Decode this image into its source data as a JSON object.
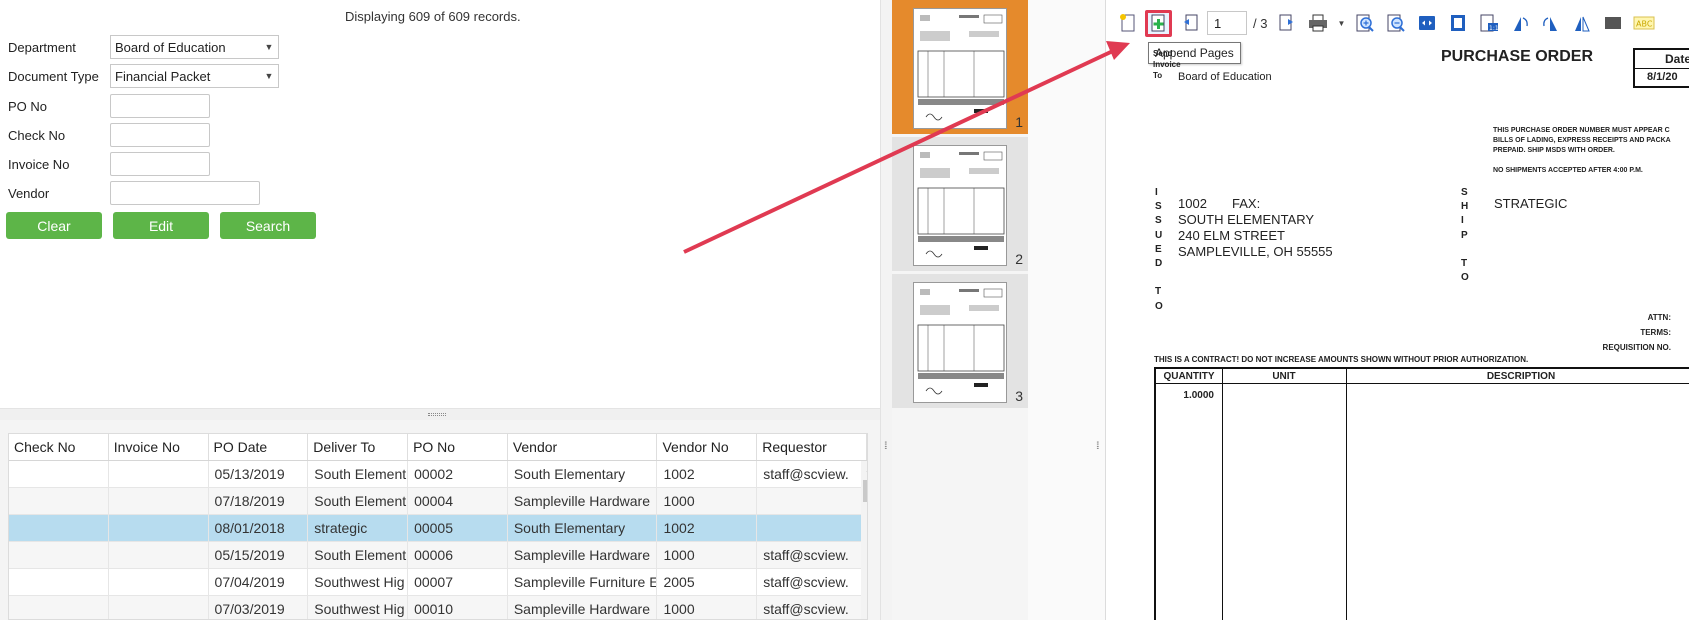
{
  "search": {
    "records_text": "Displaying 609 of 609 records.",
    "fields": [
      {
        "label": "Department",
        "value": "Board of Education",
        "type": "select"
      },
      {
        "label": "Document Type",
        "value": "Financial Packet",
        "type": "select"
      },
      {
        "label": "PO No",
        "value": "",
        "type": "text"
      },
      {
        "label": "Check No",
        "value": "",
        "type": "text"
      },
      {
        "label": "Invoice No",
        "value": "",
        "type": "text"
      },
      {
        "label": "Vendor",
        "value": "",
        "type": "text"
      }
    ],
    "buttons": {
      "clear": "Clear",
      "edit": "Edit",
      "search": "Search"
    },
    "button_color": "#5db548"
  },
  "grid": {
    "columns": [
      "Check No",
      "Invoice No",
      "PO Date",
      "Deliver To",
      "PO No",
      "Vendor",
      "Vendor No",
      "Requestor"
    ],
    "rows": [
      {
        "check_no": "",
        "invoice_no": "",
        "po_date": "05/13/2019",
        "deliver_to": "South Element",
        "po_no": "00002",
        "vendor": "South Elementary",
        "vendor_no": "1002",
        "requestor": "staff@scview."
      },
      {
        "check_no": "",
        "invoice_no": "",
        "po_date": "07/18/2019",
        "deliver_to": "South Element",
        "po_no": "00004",
        "vendor": "Sampleville Hardware",
        "vendor_no": "1000",
        "requestor": ""
      },
      {
        "check_no": "",
        "invoice_no": "",
        "po_date": "08/01/2018",
        "deliver_to": "strategic",
        "po_no": "00005",
        "vendor": "South Elementary",
        "vendor_no": "1002",
        "requestor": ""
      },
      {
        "check_no": "",
        "invoice_no": "",
        "po_date": "05/15/2019",
        "deliver_to": "South Element",
        "po_no": "00006",
        "vendor": "Sampleville Hardware",
        "vendor_no": "1000",
        "requestor": "staff@scview."
      },
      {
        "check_no": "",
        "invoice_no": "",
        "po_date": "07/04/2019",
        "deliver_to": "Southwest Hig",
        "po_no": "00007",
        "vendor": "Sampleville Furniture E",
        "vendor_no": "2005",
        "requestor": "staff@scview."
      },
      {
        "check_no": "",
        "invoice_no": "",
        "po_date": "07/03/2019",
        "deliver_to": "Southwest Hig",
        "po_no": "00010",
        "vendor": "Sampleville Hardware",
        "vendor_no": "1000",
        "requestor": "staff@scview."
      }
    ],
    "selected_index": 2,
    "selected_color": "#b7dcef"
  },
  "thumbnails": {
    "pages": [
      "1",
      "2",
      "3"
    ],
    "active_index": 0,
    "active_color": "#e58a2c"
  },
  "viewer": {
    "toolbar": {
      "page_current": "1",
      "page_total": "/ 3",
      "tooltip": "Append Pages",
      "icons": [
        "new-page-icon",
        "append-pages-icon",
        "previous-page-icon",
        "next-page-icon",
        "print-icon",
        "print-dropdown-icon",
        "zoom-in-icon",
        "zoom-out-icon",
        "fit-width-icon",
        "fit-page-icon",
        "actual-size-icon",
        "rotate-left-icon",
        "rotate-right-icon",
        "flip-icon",
        "redact-icon",
        "text-annotation-icon"
      ],
      "highlight_color": "#e03a52"
    },
    "document": {
      "title": "PURCHASE ORDER",
      "send_invoice_to": "Send\nInvoice\nTo",
      "bill_to": "Board of Education",
      "date_label": "Date",
      "date_value": "8/1/20",
      "notice": "THIS PURCHASE ORDER NUMBER MUST APPEAR C\nBILLS OF LADING, EXPRESS RECEIPTS AND PACKA\nPREPAID. SHIP MSDS WITH ORDER.\n\nNO SHIPMENTS ACCEPTED AFTER 4:00 P.M.",
      "issued_letters": "I\nS\nS\nU\nE\nD\n\nT\nO",
      "ship_letters": "S\nH\nI\nP\n\nT\nO",
      "issued_to_address": "1002\nSOUTH ELEMENTARY\n240 ELM STREET\nSAMPLEVILLE, OH 55555",
      "fax_label": "FAX:",
      "ship_to": "STRATEGIC",
      "terms_block": "ATTN:\nTERMS:\nREQUISITION NO.",
      "contract_notice": "THIS IS A CONTRACT! DO NOT INCREASE AMOUNTS SHOWN WITHOUT PRIOR AUTHORIZATION.",
      "table_headers": [
        "QUANTITY",
        "UNIT",
        "DESCRIPTION"
      ],
      "quantity": "1.0000"
    }
  },
  "annotation": {
    "arrow_color": "#e03a52"
  }
}
